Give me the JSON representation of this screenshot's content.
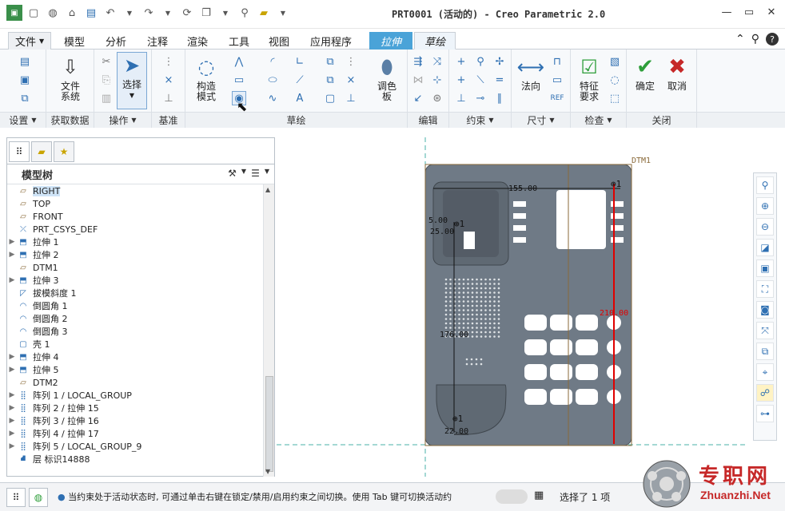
{
  "app": {
    "title": "PRT0001 (活动的) - Creo Parametric 2.0"
  },
  "menu": {
    "file": "文件",
    "tabs": [
      "模型",
      "分析",
      "注释",
      "渲染",
      "工具",
      "视图",
      "应用程序"
    ],
    "context_tab": "拉伸",
    "active_tab": "草绘"
  },
  "ribbon": {
    "groups": {
      "setup": "设置",
      "get_data": "获取数据",
      "operations": "操作",
      "datum": "基准",
      "sketch": "草绘",
      "edit": "编辑",
      "constrain": "约束",
      "dimension": "尺寸",
      "inspect": "检查",
      "close": "关闭"
    },
    "buttons": {
      "file_system": "文件\n系统",
      "select": "选择",
      "construction_mode": "构造\n模式",
      "palette": "调色\n板",
      "normal": "法向",
      "feature_requirements": "特征\n要求",
      "ok": "确定",
      "cancel": "取消"
    }
  },
  "model_tree": {
    "title": "模型树",
    "items": [
      {
        "label": "RIGHT",
        "icon": "plane",
        "exp": false,
        "selected": true
      },
      {
        "label": "TOP",
        "icon": "plane",
        "exp": false
      },
      {
        "label": "FRONT",
        "icon": "plane",
        "exp": false
      },
      {
        "label": "PRT_CSYS_DEF",
        "icon": "csys",
        "exp": false
      },
      {
        "label": "拉伸 1",
        "icon": "extrude",
        "exp": true
      },
      {
        "label": "拉伸 2",
        "icon": "extrude",
        "exp": true
      },
      {
        "label": "DTM1",
        "icon": "plane",
        "exp": false
      },
      {
        "label": "拉伸 3",
        "icon": "extrude",
        "exp": true
      },
      {
        "label": "拔模斜度 1",
        "icon": "draft",
        "exp": false
      },
      {
        "label": "倒圆角 1",
        "icon": "round",
        "exp": false
      },
      {
        "label": "倒圆角 2",
        "icon": "round",
        "exp": false
      },
      {
        "label": "倒圆角 3",
        "icon": "round",
        "exp": false
      },
      {
        "label": "壳 1",
        "icon": "shell",
        "exp": false
      },
      {
        "label": "拉伸 4",
        "icon": "extrude",
        "exp": true
      },
      {
        "label": "拉伸 5",
        "icon": "extrude",
        "exp": true
      },
      {
        "label": "DTM2",
        "icon": "plane",
        "exp": false
      },
      {
        "label": "阵列 1 / LOCAL_GROUP",
        "icon": "pattern",
        "exp": true
      },
      {
        "label": "阵列 2 / 拉伸 15",
        "icon": "pattern",
        "exp": true
      },
      {
        "label": "阵列 3 / 拉伸 16",
        "icon": "pattern",
        "exp": true
      },
      {
        "label": "阵列 4 / 拉伸 17",
        "icon": "pattern",
        "exp": true
      },
      {
        "label": "阵列 5 / LOCAL_GROUP_9",
        "icon": "pattern",
        "exp": true
      },
      {
        "label": "层 标识14888",
        "icon": "layer",
        "exp": false
      }
    ]
  },
  "sketch": {
    "datum_label": "DTM1",
    "dims": {
      "d1": "155.00",
      "d2": "5.00",
      "d3": "25.00",
      "d4": "176.00",
      "d5": "210.00",
      "d6": "22.00"
    }
  },
  "status": {
    "message": "当约束处于活动状态时, 可通过单击右键在锁定/禁用/启用约束之间切换。使用 Tab 键可切换活动约",
    "selection": "选择了 1 项"
  },
  "watermark": {
    "cn": "专职网",
    "url": "Zhuanzhi.Net"
  },
  "colors": {
    "accent": "#4aa3d8",
    "dim_red": "#e00000",
    "part_gray": "#6f7a86"
  }
}
